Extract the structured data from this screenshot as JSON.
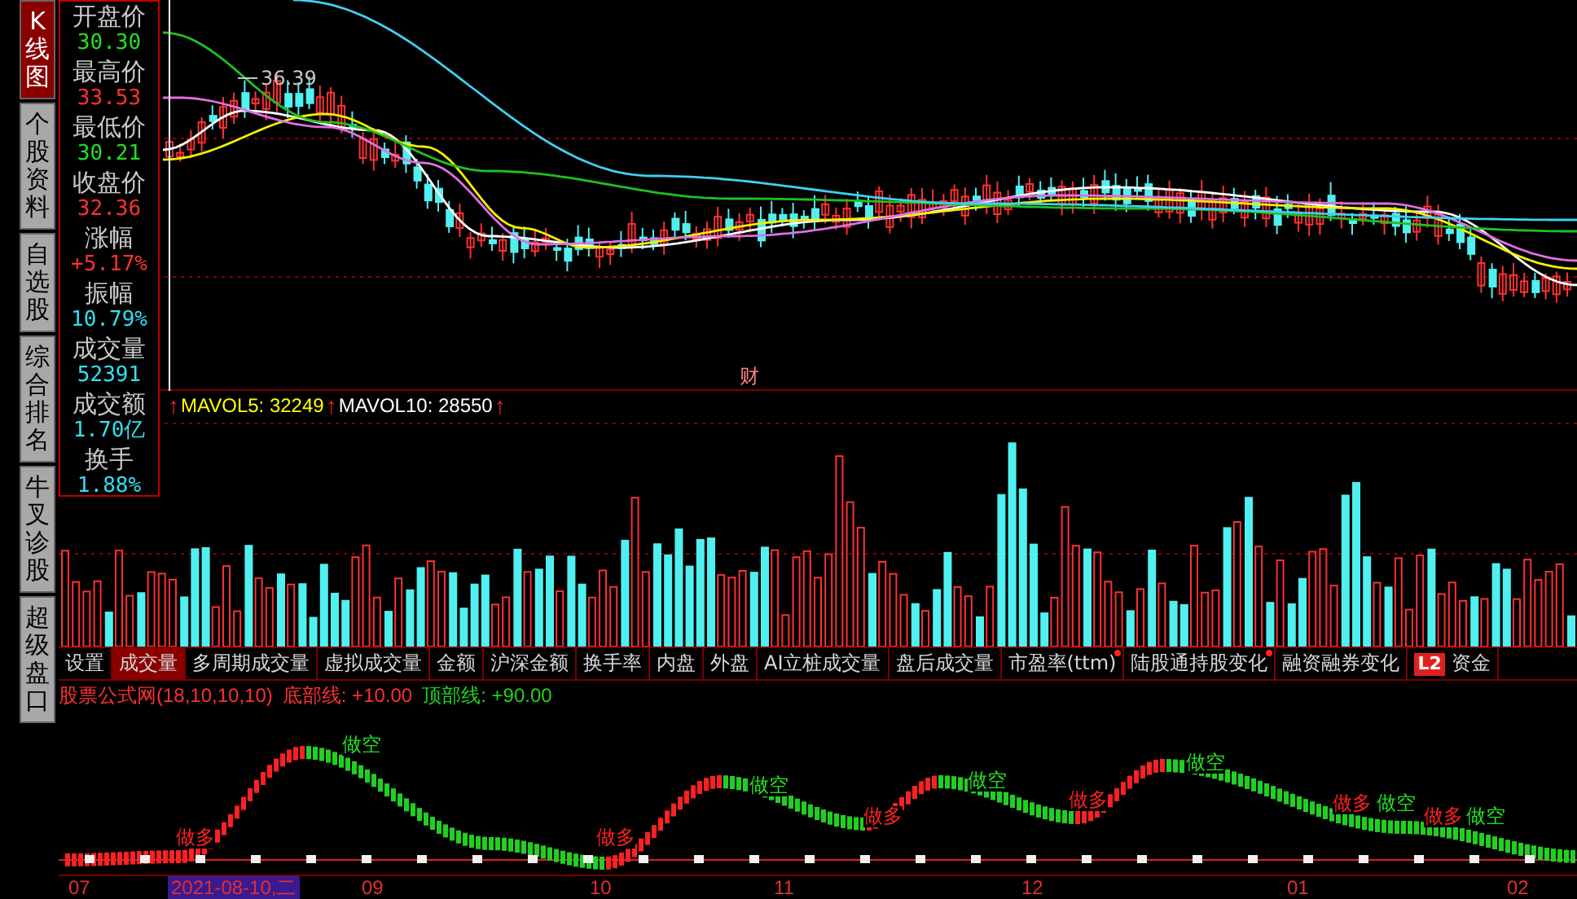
{
  "side_tabs": [
    {
      "label": "K线图",
      "selected": true
    },
    {
      "label": "个股资料",
      "selected": false
    },
    {
      "label": "自选股",
      "selected": false
    },
    {
      "label": "综合排名",
      "selected": false
    },
    {
      "label": "牛叉诊股",
      "selected": false
    },
    {
      "label": "超级盘口",
      "selected": false
    }
  ],
  "quote_panel": {
    "rows": [
      {
        "label": "开盘价",
        "value": "30.30",
        "kind": "down"
      },
      {
        "label": "最高价",
        "value": "33.53",
        "kind": "up"
      },
      {
        "label": "最低价",
        "value": "30.21",
        "kind": "down"
      },
      {
        "label": "收盘价",
        "value": "32.36",
        "kind": "up"
      },
      {
        "label": "涨幅",
        "value": "+5.17%",
        "kind": "up"
      },
      {
        "label": "振幅",
        "value": "10.79%",
        "kind": "flat"
      },
      {
        "label": "成交量",
        "value": "52391",
        "kind": "flat"
      },
      {
        "label": "成交额",
        "value": "1.70亿",
        "kind": "flat"
      },
      {
        "label": "换手",
        "value": "1.88%",
        "kind": "flat"
      }
    ]
  },
  "price_chart": {
    "high_label": "36.39",
    "marker": "财"
  },
  "volume_panel": {
    "legend": [
      {
        "kind": "arrow",
        "text": "↑",
        "color": "#ff2020"
      },
      {
        "kind": "line",
        "text": "MAVOL5: 32249",
        "color": "#ffff00"
      },
      {
        "kind": "arrow",
        "text": "↑",
        "color": "#ff2020"
      },
      {
        "kind": "line",
        "text": "MAVOL10: 28550",
        "color": "#ffffff"
      },
      {
        "kind": "arrow",
        "text": "↑",
        "color": "#ff2020"
      }
    ]
  },
  "indicator_tabs": [
    {
      "label": "设置",
      "selected": false,
      "dot": false
    },
    {
      "label": "成交量",
      "selected": true,
      "dot": false
    },
    {
      "label": "多周期成交量",
      "selected": false,
      "dot": false
    },
    {
      "label": "虚拟成交量",
      "selected": false,
      "dot": false
    },
    {
      "label": "金额",
      "selected": false,
      "dot": false
    },
    {
      "label": "沪深金额",
      "selected": false,
      "dot": false
    },
    {
      "label": "换手率",
      "selected": false,
      "dot": false
    },
    {
      "label": "内盘",
      "selected": false,
      "dot": false
    },
    {
      "label": "外盘",
      "selected": false,
      "dot": false
    },
    {
      "label": "AI立桩成交量",
      "selected": false,
      "dot": false
    },
    {
      "label": "盘后成交量",
      "selected": false,
      "dot": false
    },
    {
      "label": "市盈率(ttm)",
      "selected": false,
      "dot": true
    },
    {
      "label": "陆股通持股变化",
      "selected": false,
      "dot": true
    },
    {
      "label": "融资融券变化",
      "selected": false,
      "dot": false
    },
    {
      "label": "资金",
      "selected": false,
      "dot": false,
      "badge": "L2"
    }
  ],
  "indicator_panel": {
    "title": "股票公式网(18,10,10,10)",
    "bottom_label": "底部线: +10.00",
    "top_label": "顶部线: +90.00",
    "signals": [
      {
        "kind": "long",
        "label": "做多"
      },
      {
        "kind": "short",
        "label": "做空"
      },
      {
        "kind": "long",
        "label": "做多"
      },
      {
        "kind": "short",
        "label": "做空"
      },
      {
        "kind": "long",
        "label": "做多"
      },
      {
        "kind": "short",
        "label": "做空"
      },
      {
        "kind": "long",
        "label": "做多"
      },
      {
        "kind": "short",
        "label": "做空"
      },
      {
        "kind": "long",
        "label": "做多"
      },
      {
        "kind": "short",
        "label": "做空"
      },
      {
        "kind": "long",
        "label": "做多"
      },
      {
        "kind": "short",
        "label": "做空"
      }
    ]
  },
  "time_axis": {
    "labels": [
      {
        "text": "07",
        "selected": false
      },
      {
        "text": "2021-08-10,二",
        "selected": true
      },
      {
        "text": "09",
        "selected": false
      },
      {
        "text": "10",
        "selected": false
      },
      {
        "text": "11",
        "selected": false
      },
      {
        "text": "12",
        "selected": false
      },
      {
        "text": "01",
        "selected": false
      },
      {
        "text": "02",
        "selected": false
      }
    ]
  }
}
